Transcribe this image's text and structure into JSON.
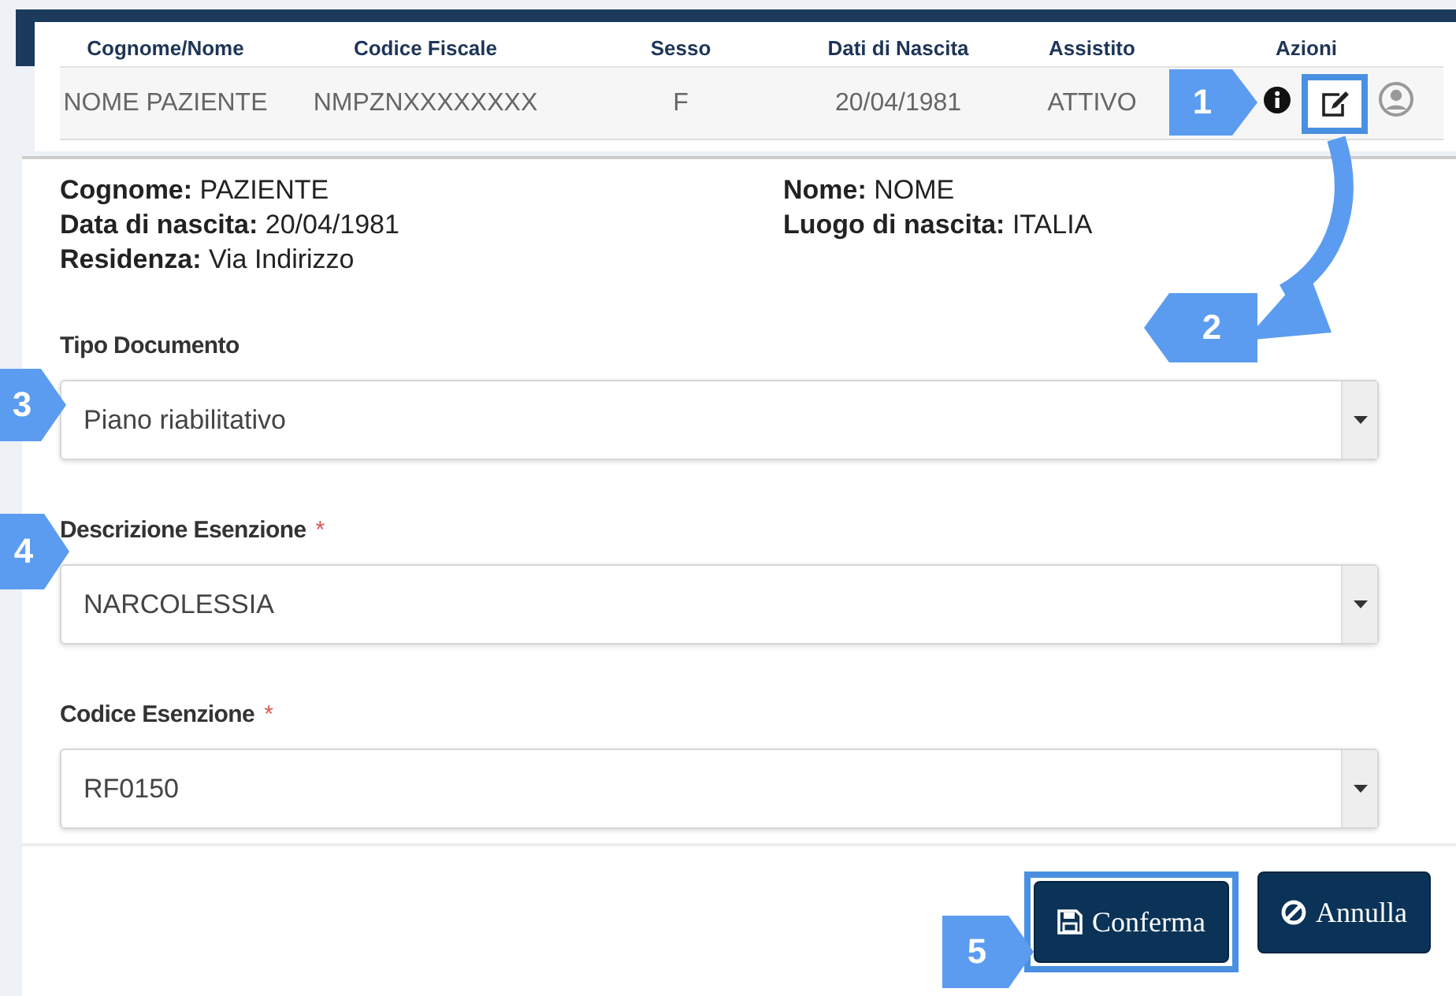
{
  "table": {
    "columns": [
      "Cognome/Nome",
      "Codice Fiscale",
      "Sesso",
      "Dati di Nascita",
      "Assistito",
      "Azioni"
    ],
    "rows": [
      {
        "cells": [
          "NOME PAZIENTE",
          "NMPZNXXXXXXXX",
          "F",
          "20/04/1981",
          "ATTIVO"
        ],
        "actions": [
          {
            "kind": "info",
            "highlighted": false
          },
          {
            "kind": "edit",
            "highlighted": true
          },
          {
            "kind": "user",
            "highlighted": false
          }
        ]
      }
    ]
  },
  "patient": [
    {
      "label": "Cognome:",
      "value": "PAZIENTE"
    },
    {
      "label": "Nome:",
      "value": "NOME"
    },
    {
      "label": "Data di nascita:",
      "value": "20/04/1981"
    },
    {
      "label": "Luogo di nascita:",
      "value": "ITALIA"
    },
    {
      "label": "Residenza:",
      "value": "Via Indirizzo"
    }
  ],
  "fields": [
    {
      "label": "Tipo Documento",
      "value": "Piano riabilitativo"
    },
    {
      "label": "Descrizione Esenzione",
      "required_mark": "*",
      "value": "NARCOLESSIA"
    },
    {
      "label": "Codice Esenzione",
      "required_mark": "*",
      "value": "RF0150"
    }
  ],
  "buttons": [
    {
      "kind": "save",
      "label": "Conferma",
      "highlighted": true
    },
    {
      "kind": "cancel",
      "label": "Annulla",
      "highlighted": false
    }
  ],
  "callouts": [
    "1",
    "2",
    "3",
    "4",
    "5"
  ]
}
